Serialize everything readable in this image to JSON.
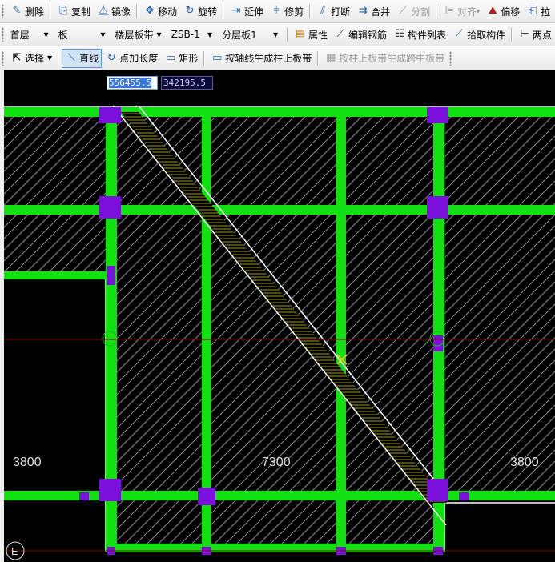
{
  "toolbar1": {
    "delete": "删除",
    "copy": "复制",
    "mirror": "镜像",
    "move": "移动",
    "rotate": "旋转",
    "extend": "延伸",
    "trim": "修剪",
    "break": "打断",
    "merge": "合并",
    "split": "分割",
    "align": "对齐",
    "offset": "偏移",
    "pick": "拉"
  },
  "toolbar2": {
    "floor": "首层",
    "category": "板",
    "subcategory": "楼层板带",
    "component": "ZSB-1",
    "layer": "分层板1",
    "properties": "属性",
    "edit_rebar": "编辑钢筋",
    "component_list": "构件列表",
    "pick_component": "拾取构件",
    "two_points": "两点"
  },
  "toolbar3": {
    "select": "选择",
    "line": "直线",
    "point_length": "点加长度",
    "rectangle": "矩形",
    "gen_column_strip": "按轴线生成柱上板带",
    "gen_middle_strip": "按柱上板带生成跨中板带"
  },
  "coords": {
    "x": "556455.5",
    "y": "342195.5"
  },
  "drawing": {
    "dim_left": "3800",
    "dim_center": "7300",
    "dim_right": "3800",
    "axis_label": "E",
    "colors": {
      "beam": "#11e011",
      "column": "#7b10dc",
      "hatch": "#8c8c8c",
      "axis": "#8b0000",
      "strip_outline": "#ffffff",
      "strip_fill": "#a09800",
      "text": "#e0e0e0"
    }
  }
}
